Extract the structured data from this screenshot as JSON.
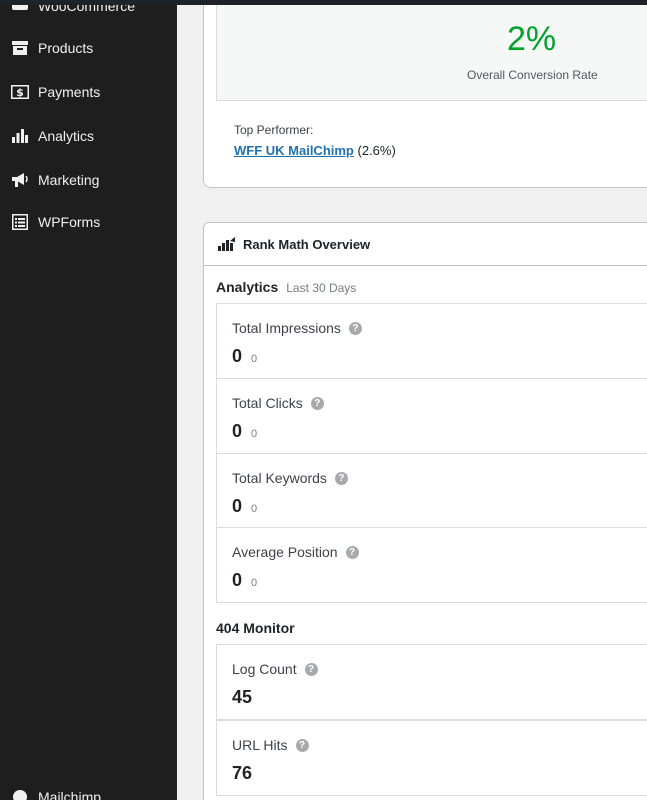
{
  "sidebar": {
    "items": [
      {
        "label": "WooCommerce",
        "icon": "woocommerce-icon"
      },
      {
        "label": "Products",
        "icon": "products-icon"
      },
      {
        "label": "Payments",
        "icon": "payments-icon"
      },
      {
        "label": "Analytics",
        "icon": "analytics-icon"
      },
      {
        "label": "Marketing",
        "icon": "marketing-icon"
      },
      {
        "label": "WPForms",
        "icon": "wpforms-icon"
      },
      {
        "label": "Mailchimp",
        "icon": "mailchimp-icon"
      }
    ]
  },
  "conversion": {
    "value": "2%",
    "label": "Overall Conversion Rate",
    "top_performer_label": "Top Performer:",
    "top_performer_name": "WFF UK MailChimp",
    "top_performer_rate": "(2.6%)"
  },
  "rank_math": {
    "title": "Rank Math Overview",
    "analytics": {
      "title": "Analytics",
      "period": "Last 30 Days",
      "stats": [
        {
          "label": "Total Impressions",
          "value": "0",
          "diff": "0"
        },
        {
          "label": "Total Clicks",
          "value": "0",
          "diff": "0"
        },
        {
          "label": "Total Keywords",
          "value": "0",
          "diff": "0"
        },
        {
          "label": "Average Position",
          "value": "0",
          "diff": "0"
        }
      ]
    },
    "monitor": {
      "title": "404 Monitor",
      "stats": [
        {
          "label": "Log Count",
          "value": "45"
        },
        {
          "label": "URL Hits",
          "value": "76"
        }
      ]
    }
  },
  "colors": {
    "sidebar_bg": "#1e1e1e",
    "accent_green": "#00a32a",
    "link_blue": "#2271b1"
  }
}
